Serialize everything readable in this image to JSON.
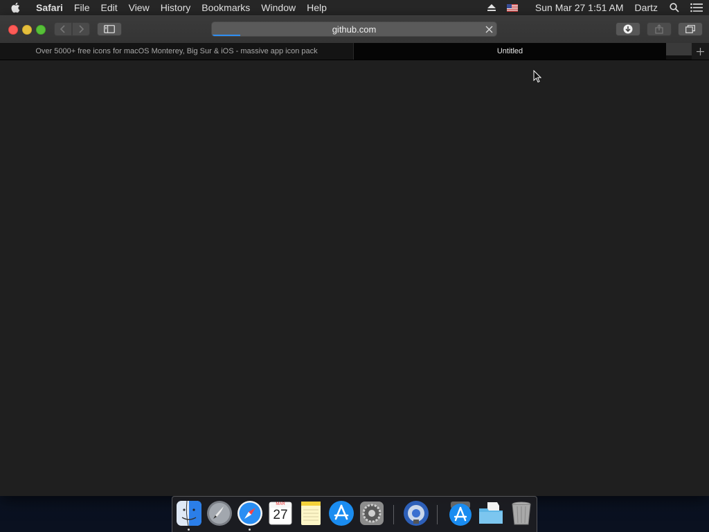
{
  "menubar": {
    "app_name": "Safari",
    "menus": [
      "File",
      "Edit",
      "View",
      "History",
      "Bookmarks",
      "Window",
      "Help"
    ],
    "clock": "Sun Mar 27  1:51 AM",
    "user": "Dartz",
    "status_icons": [
      "eject-icon",
      "us-flag-input-icon",
      "spotlight-search-icon",
      "notification-center-icon"
    ]
  },
  "toolbar": {
    "address": "github.com",
    "load_progress": 0.1
  },
  "tabs": [
    {
      "title": "Over 5000+ free icons for macOS Monterey, Big Sur & iOS - massive app icon pack",
      "active": false
    },
    {
      "title": "Untitled",
      "active": true
    }
  ],
  "dock": {
    "items": [
      "finder-icon",
      "launchpad-icon",
      "safari-icon",
      "calendar-icon",
      "notes-icon",
      "app-store-icon",
      "system-preferences-icon",
      "bluetooth-screen-sharing-icon",
      "app-store-folder-icon",
      "documents-folder-icon",
      "trash-icon"
    ],
    "calendar": {
      "month": "MAR",
      "day": "27"
    }
  },
  "colors": {
    "accent": "#2f8ff4",
    "close": "#fc5b57",
    "minimize": "#e5bf3c",
    "maximize": "#57c038"
  }
}
